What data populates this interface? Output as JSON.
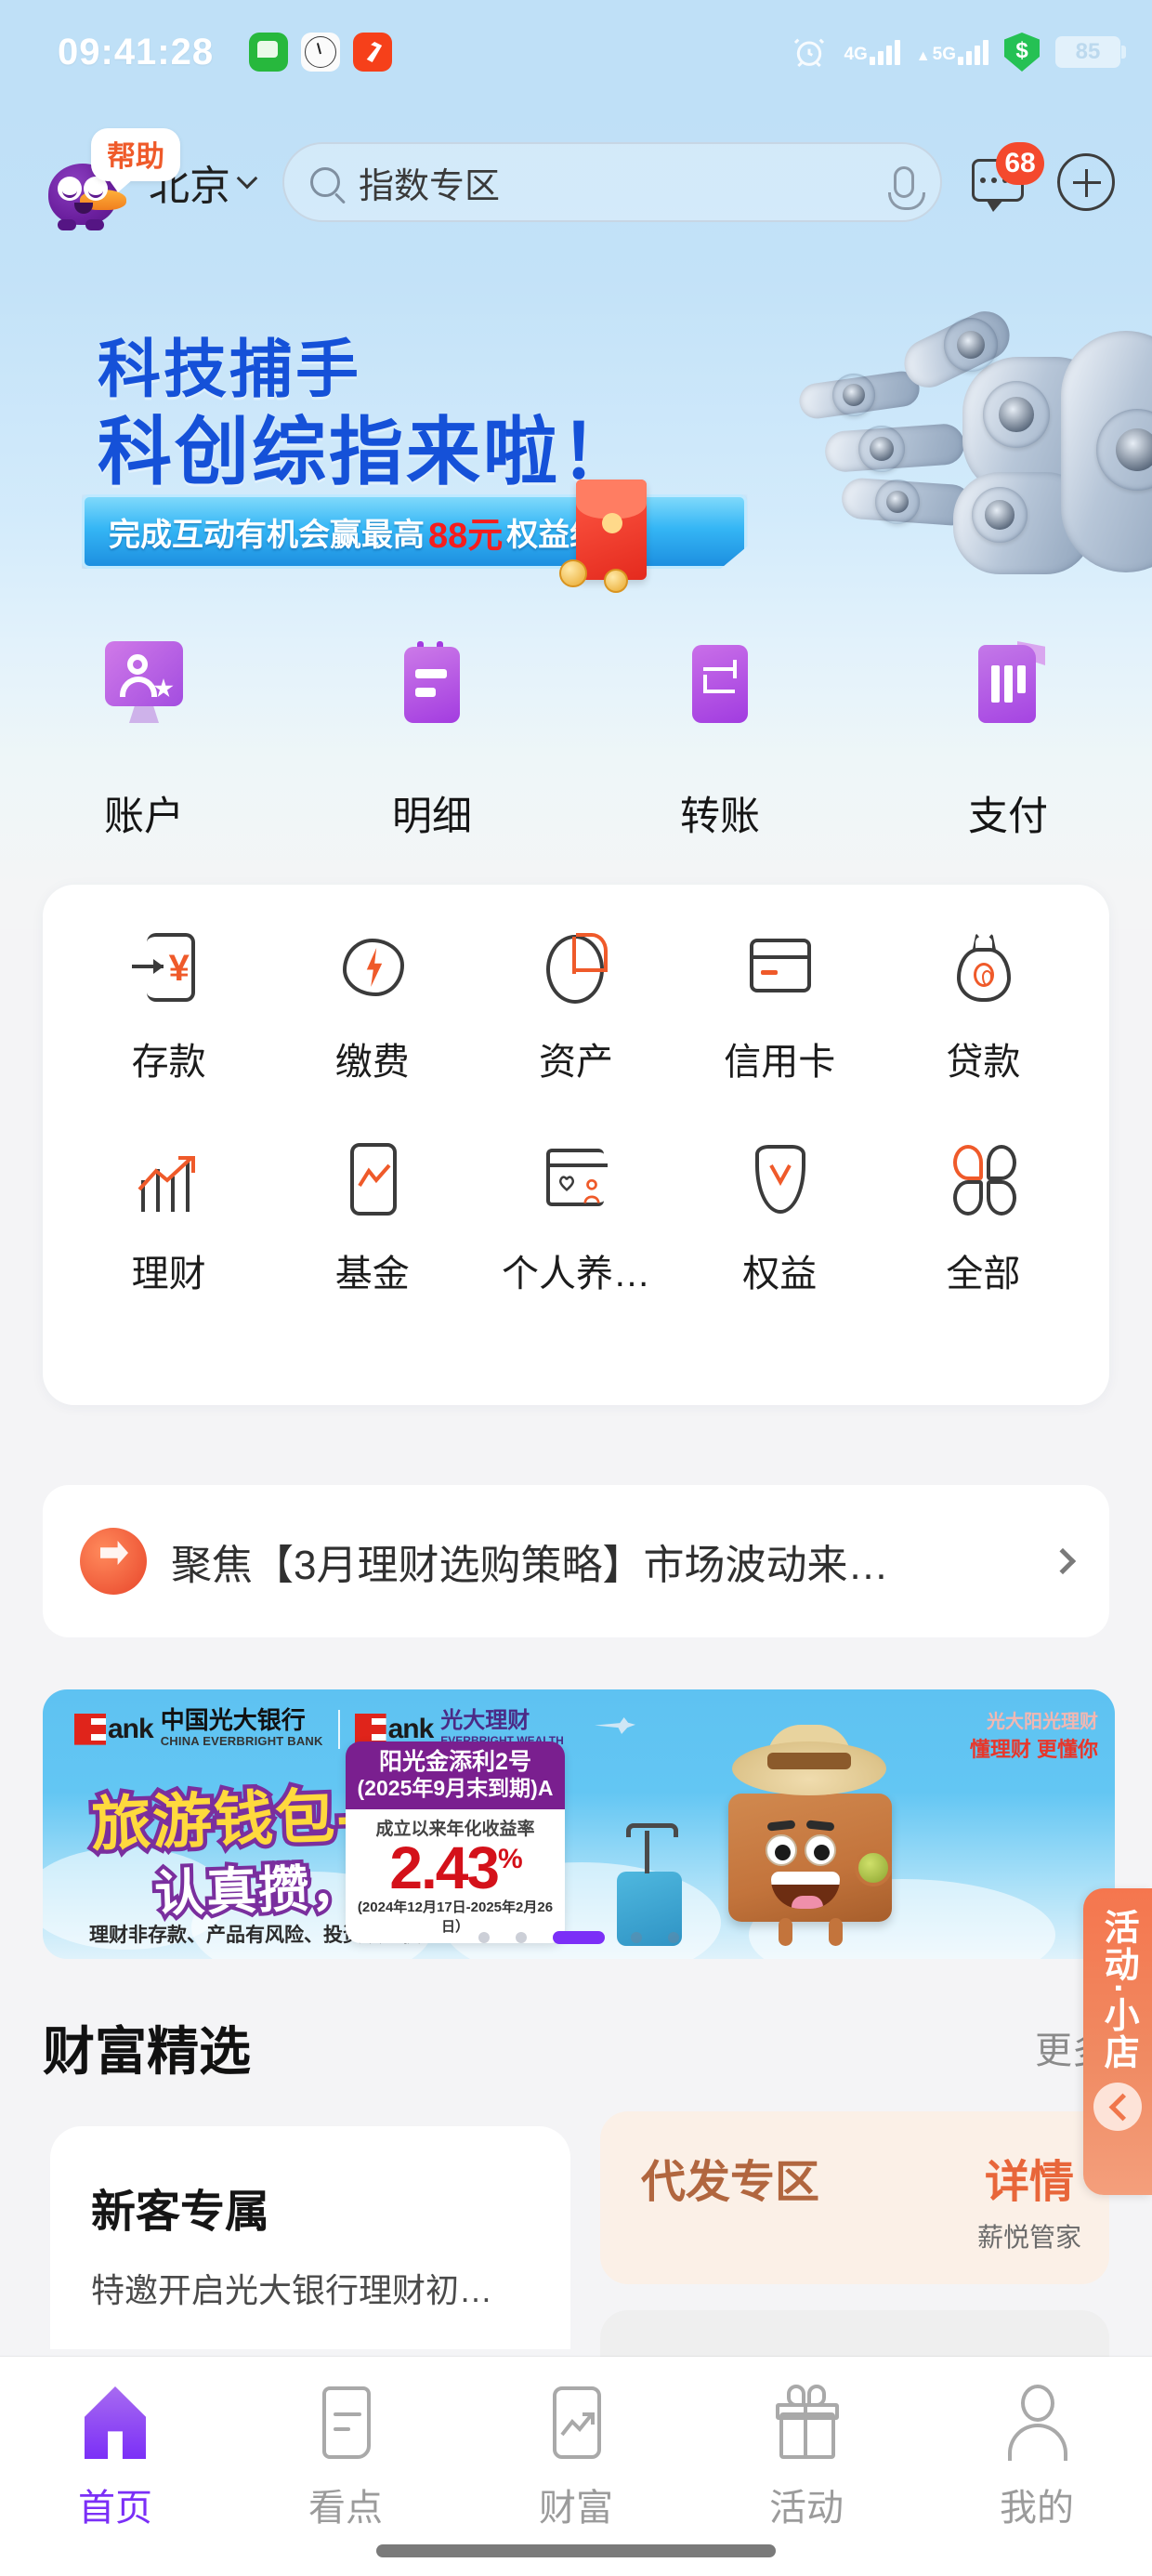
{
  "status_bar": {
    "time": "09:41:28",
    "app_icons": [
      "message-icon",
      "clock-icon",
      "finance-app-icon"
    ],
    "alarm_icon": "alarm-icon",
    "sim1_network": "4G",
    "sim2_network": "5G",
    "security_icon": "money-shield-icon",
    "battery_level": "85"
  },
  "header": {
    "assistant_bubble": "帮助",
    "assistant_avatar": "purple-mascot-avatar",
    "city": "北京",
    "search_placeholder": "指数专区",
    "search_icon": "search-icon",
    "mic_icon": "microphone-icon",
    "message_icon": "message-icon",
    "message_badge": "68",
    "add_icon": "plus-icon"
  },
  "hero": {
    "line1": "科技捕手",
    "line2": "科创综指来啦！",
    "pill_prefix": "完成互动有机会赢最高",
    "pill_amount": "88元",
    "pill_suffix": "权益红包"
  },
  "quick_actions": [
    {
      "label": "账户",
      "icon": "account-icon"
    },
    {
      "label": "明细",
      "icon": "statement-icon"
    },
    {
      "label": "转账",
      "icon": "transfer-icon"
    },
    {
      "label": "支付",
      "icon": "payment-icon"
    }
  ],
  "service_grid": {
    "row1": [
      {
        "label": "存款",
        "icon": "deposit-icon"
      },
      {
        "label": "缴费",
        "icon": "bill-payment-icon"
      },
      {
        "label": "资产",
        "icon": "assets-pie-icon"
      },
      {
        "label": "信用卡",
        "icon": "credit-card-icon"
      },
      {
        "label": "贷款",
        "icon": "loan-moneybag-icon"
      }
    ],
    "row2": [
      {
        "label": "理财",
        "icon": "wealth-chart-icon"
      },
      {
        "label": "基金",
        "icon": "fund-icon"
      },
      {
        "label": "个人养…",
        "icon": "pension-icon"
      },
      {
        "label": "权益",
        "icon": "benefits-icon"
      },
      {
        "label": "全部",
        "icon": "all-services-icon"
      }
    ]
  },
  "focus_bar": {
    "icon": "focus-megaphone-icon",
    "text": "聚焦【3月理财选购策略】市场波动来…",
    "chevron": "chevron-right-icon"
  },
  "ad_banner": {
    "bank_cn": "中国光大银行",
    "bank_en": "CHINA EVERBRIGHT BANK",
    "wealth_cn": "光大理财",
    "wealth_en": "EVERBRIGHT WEALTH",
    "logo_word": "ank",
    "title_line1": "旅游钱包-随心购",
    "title_line2": "认真攒，开心花！",
    "disclaimer": "理财非存款、产品有风险、投资须谨慎。",
    "product_name_line1": "阳光金添利2号",
    "product_name_line2": "(2025年9月末到期)A",
    "rate_label": "成立以来年化收益率",
    "rate_value": "2.43",
    "rate_unit": "%",
    "rate_period": "(2024年12月17日-2025年2月26日）",
    "slogan_line1": "光大阳光理财",
    "slogan_line2": "懂理财 更懂你",
    "dots_total": 5,
    "dots_active_index": 2
  },
  "wealth_section": {
    "title": "财富精选",
    "more": "更多",
    "card_left": {
      "title": "新客专属",
      "subtitle": "特邀开启光大银行理财初…"
    },
    "card_right": {
      "title": "代发专区",
      "detail": "详情",
      "sub": "薪悦管家"
    }
  },
  "side_fab": {
    "label": "活动·小店",
    "collapse_icon": "chevron-left-icon"
  },
  "bottom_nav": [
    {
      "label": "首页",
      "icon": "home-icon",
      "active": true
    },
    {
      "label": "看点",
      "icon": "news-icon",
      "active": false
    },
    {
      "label": "财富",
      "icon": "wealth-icon",
      "active": false
    },
    {
      "label": "活动",
      "icon": "gift-icon",
      "active": false
    },
    {
      "label": "我的",
      "icon": "profile-icon",
      "active": false
    }
  ],
  "colors": {
    "brand_purple": "#7b2ff7",
    "accent_orange": "#ef5a2a",
    "sky_blue": "#bfe0f7",
    "hero_blue": "#1551d8",
    "badge_red": "#f4492d",
    "rate_red": "#d4111a"
  }
}
